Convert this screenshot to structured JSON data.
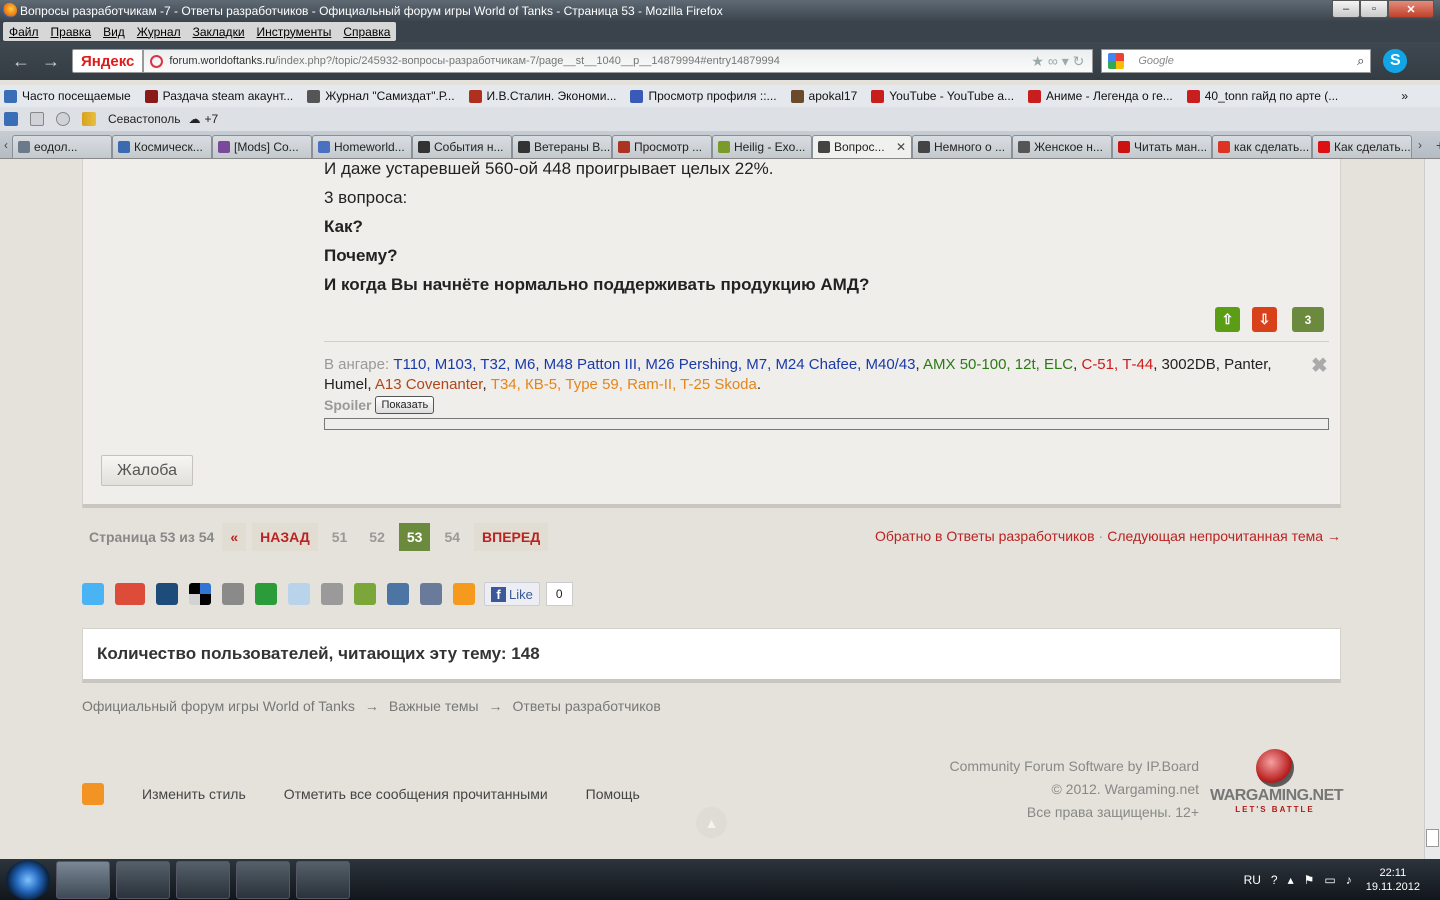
{
  "window": {
    "title": "Вопросы разработчикам -7 - Ответы разработчиков - Официальный форум игры World of Tanks - Страница 53 - Mozilla Firefox"
  },
  "menu": [
    "Файл",
    "Правка",
    "Вид",
    "Журнал",
    "Закладки",
    "Инструменты",
    "Справка"
  ],
  "nav": {
    "yandex_logo": "Яндекс",
    "url_domain": "forum.worldoftanks.ru",
    "url_path": "/index.php?/topic/245932-вопросы-разработчикам-7/page__st__1040__p__14879994#entry14879994",
    "search_placeholder": "Google"
  },
  "bookmarks": [
    "Часто посещаемые",
    "Раздача steam акаунт...",
    "Журнал \"Самиздат\".Р...",
    "И.В.Сталин. Экономи...",
    "Просмотр профиля ::...",
    "apokal17",
    "YouTube - YouTube а...",
    "Аниме - Легенда о ге...",
    "40_tonn гайд по арте (..."
  ],
  "bookmarks_more": "»",
  "yabar": {
    "city": "Севастополь",
    "temp": "+7"
  },
  "tabs": [
    {
      "label": "еодол...",
      "color": "#6a7a8a"
    },
    {
      "label": "Космическ...",
      "color": "#3a6ab0"
    },
    {
      "label": "[Mods] Co...",
      "color": "#7a4a9a"
    },
    {
      "label": "Homeworld...",
      "color": "#4a70c0"
    },
    {
      "label": "События н...",
      "color": "#333333"
    },
    {
      "label": "Ветераны В...",
      "color": "#333333"
    },
    {
      "label": "Просмотр ...",
      "color": "#aa3322"
    },
    {
      "label": "Heilig - Exo...",
      "color": "#7a9a2a"
    },
    {
      "label": "Вопрос...",
      "color": "#444444",
      "active": true
    },
    {
      "label": "Немного о ...",
      "color": "#444444"
    },
    {
      "label": "Женское н...",
      "color": "#555555"
    },
    {
      "label": "Читать ман...",
      "color": "#cc1111"
    },
    {
      "label": "как сделать...",
      "color": "#dd3322"
    },
    {
      "label": "Как сделать...",
      "color": "#dd1111"
    }
  ],
  "post": {
    "lines": [
      "И даже устаревшей 560-ой 448 проигрывает целых 22%.",
      "3 вопроса:",
      "Как?",
      "Почему?",
      "И когда Вы начнёте нормально поддерживать продукцию АМД?"
    ],
    "vote_count": "3",
    "hangar_label": "В ангаре:",
    "hangar": [
      {
        "t": "T110, M103, T32, M6, M48 Patton III, M26 Pershing, M7, M24 Chafee, M40/43",
        "c": "blue"
      },
      {
        "t": ", ",
        "c": "plain"
      },
      {
        "t": "AMX 50-100, 12t, ELC",
        "c": "green"
      },
      {
        "t": ", ",
        "c": "plain"
      },
      {
        "t": "С-51, Т-44",
        "c": "red"
      },
      {
        "t": ", 3002DB, Panter, Humel, ",
        "c": "plain"
      },
      {
        "t": "A13 Covenanter",
        "c": "brown"
      },
      {
        "t": ", ",
        "c": "plain"
      },
      {
        "t": "Т34, КВ-5, Type 59, Ram-II, T-25 Skoda",
        "c": "orange"
      },
      {
        "t": ".",
        "c": "plain"
      }
    ],
    "spoiler_label": "Spoiler",
    "spoiler_button": "Показать",
    "report_button": "Жалоба"
  },
  "pager": {
    "info": "Страница 53 из 54",
    "first": "«",
    "prev": "НАЗАД",
    "pages": [
      "51",
      "52",
      "53",
      "54"
    ],
    "current": "53",
    "next": "ВПЕРЕД"
  },
  "backlinks": {
    "back": "Обратно в Ответы разработчиков",
    "sep": "·",
    "next": "Следующая непрочитанная тема →"
  },
  "share": {
    "like": "Like",
    "like_count": "0"
  },
  "readers": "Количество пользователей, читающих эту тему: 148",
  "breadcrumbs": [
    "Официальный форум игры World of Tanks",
    "Важные темы",
    "Ответы разработчиков"
  ],
  "breadcrumb_sep": "→",
  "credits": [
    "Community Forum Software by IP.Board",
    "© 2012. Wargaming.net",
    "Все права защищены. 12+"
  ],
  "brand": {
    "name": "WARGAMING.NET",
    "slogan": "LET'S BATTLE"
  },
  "footer": [
    "Изменить стиль",
    "Отметить все сообщения прочитанными",
    "Помощь"
  ],
  "tray": {
    "lang": "RU",
    "time": "22:11",
    "date": "19.11.2012"
  }
}
